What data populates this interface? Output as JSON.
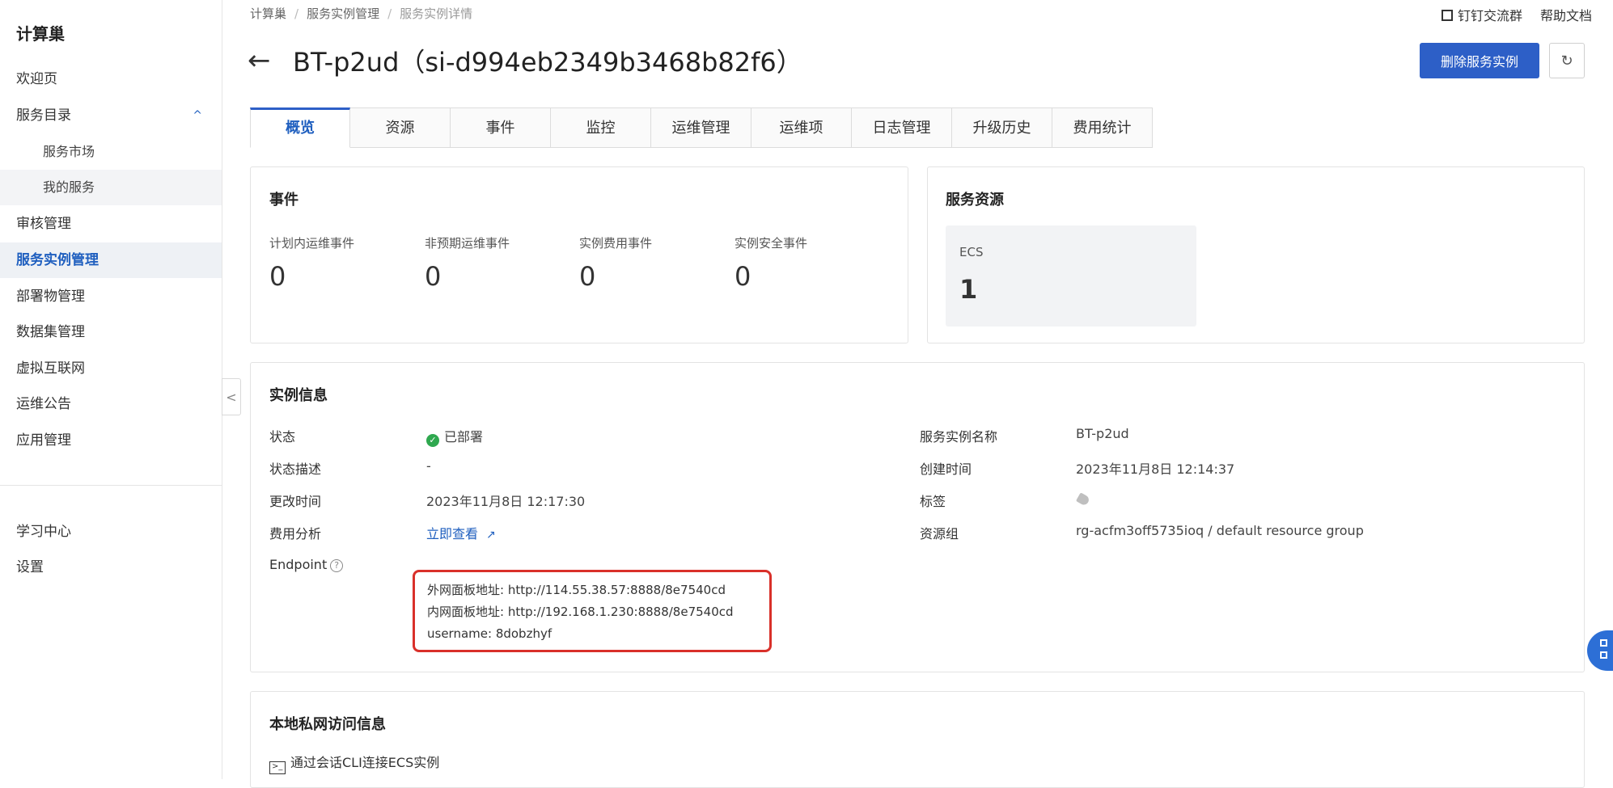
{
  "sidebar": {
    "title": "计算巢",
    "items": [
      {
        "label": "欢迎页"
      },
      {
        "label": "服务目录"
      },
      {
        "label": "服务市场"
      },
      {
        "label": "我的服务"
      },
      {
        "label": "审核管理"
      },
      {
        "label": "服务实例管理"
      },
      {
        "label": "部署物管理"
      },
      {
        "label": "数据集管理"
      },
      {
        "label": "虚拟互联网"
      },
      {
        "label": "运维公告"
      },
      {
        "label": "应用管理"
      },
      {
        "label": "学习中心"
      },
      {
        "label": "设置"
      }
    ],
    "collapse_glyph": "<",
    "chevron_glyph": "^"
  },
  "breadcrumb": [
    "计算巢",
    "服务实例管理",
    "服务实例详情"
  ],
  "top_links": {
    "group": "钉钉交流群",
    "help": "帮助文档"
  },
  "page": {
    "back_glyph": "←",
    "title": "BT-p2ud（si-d994eb2349b3468b82f6）",
    "delete_label": "删除服务实例",
    "refresh_glyph": "↻"
  },
  "tabs": [
    {
      "label": "概览"
    },
    {
      "label": "资源"
    },
    {
      "label": "事件"
    },
    {
      "label": "监控"
    },
    {
      "label": "运维管理"
    },
    {
      "label": "运维项"
    },
    {
      "label": "日志管理"
    },
    {
      "label": "升级历史"
    },
    {
      "label": "费用统计"
    }
  ],
  "events": {
    "title": "事件",
    "items": [
      {
        "label": "计划内运维事件",
        "value": "0"
      },
      {
        "label": "非预期运维事件",
        "value": "0"
      },
      {
        "label": "实例费用事件",
        "value": "0"
      },
      {
        "label": "实例安全事件",
        "value": "0"
      }
    ]
  },
  "resources": {
    "title": "服务资源",
    "ecs_label": "ECS",
    "ecs_value": "1"
  },
  "instance": {
    "title": "实例信息",
    "status_label": "状态",
    "status_value": "已部署",
    "desc_label": "状态描述",
    "desc_value": "-",
    "updated_label": "更改时间",
    "updated_value": "2023年11月8日 12:17:30",
    "cost_label": "费用分析",
    "cost_link": "立即查看",
    "endpoint_label": "Endpoint",
    "name_label": "服务实例名称",
    "name_value": "BT-p2ud",
    "created_label": "创建时间",
    "created_value": "2023年11月8日 12:14:37",
    "tags_label": "标签",
    "rg_label": "资源组",
    "rg_value": "rg-acfm3off5735ioq / default resource group",
    "endpoint_lines": [
      "外网面板地址:  http://114.55.38.57:8888/8e7540cd",
      "内网面板地址:  http://192.168.1.230:8888/8e7540cd",
      "username: 8dobzhyf"
    ]
  },
  "private_access": {
    "title": "本地私网访问信息",
    "cli_label": "通过会话CLI连接ECS实例"
  },
  "colors": {
    "accent": "#2d5fc7",
    "highlight_border": "#d9302a",
    "status_ok": "#2fa84f"
  }
}
